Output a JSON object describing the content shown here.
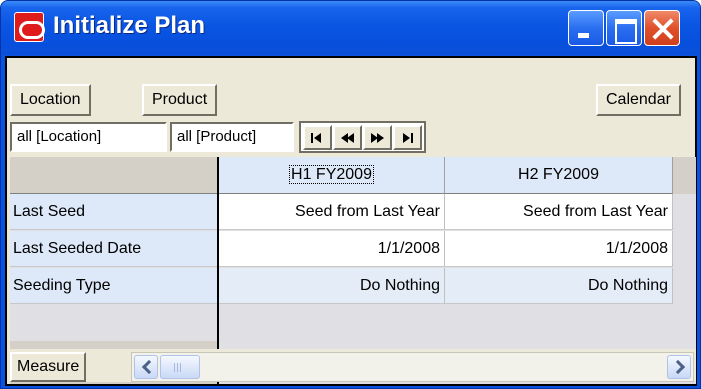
{
  "window": {
    "title": "Initialize Plan"
  },
  "toolbar": {
    "location_label": "Location",
    "product_label": "Product",
    "calendar_label": "Calendar"
  },
  "filters": {
    "location": "all [Location]",
    "product": "all [Product]"
  },
  "grid": {
    "columns": [
      "H1 FY2009",
      "H2 FY2009"
    ],
    "rows": [
      {
        "label": "Last Seed",
        "values": [
          "Seed from Last Year",
          "Seed from Last Year"
        ]
      },
      {
        "label": "Last Seeded Date",
        "values": [
          "1/1/2008",
          "1/1/2008"
        ]
      },
      {
        "label": "Seeding Type",
        "values": [
          "Do Nothing",
          "Do Nothing"
        ]
      }
    ]
  },
  "footer": {
    "measure_label": "Measure"
  },
  "icons": {
    "app": "oracle-logo-icon",
    "minimize": "minimize-icon",
    "maximize": "maximize-icon",
    "close": "close-icon",
    "nav": [
      "first-page-icon",
      "previous-page-icon",
      "next-page-icon",
      "last-page-icon"
    ],
    "scroll": [
      "scroll-left-icon",
      "scroll-right-icon"
    ]
  },
  "colors": {
    "titlebar": "#0a55e2",
    "header_cell": "#dde8f8",
    "alt_row": "#e4ecf7",
    "close_button": "#e0502a"
  }
}
